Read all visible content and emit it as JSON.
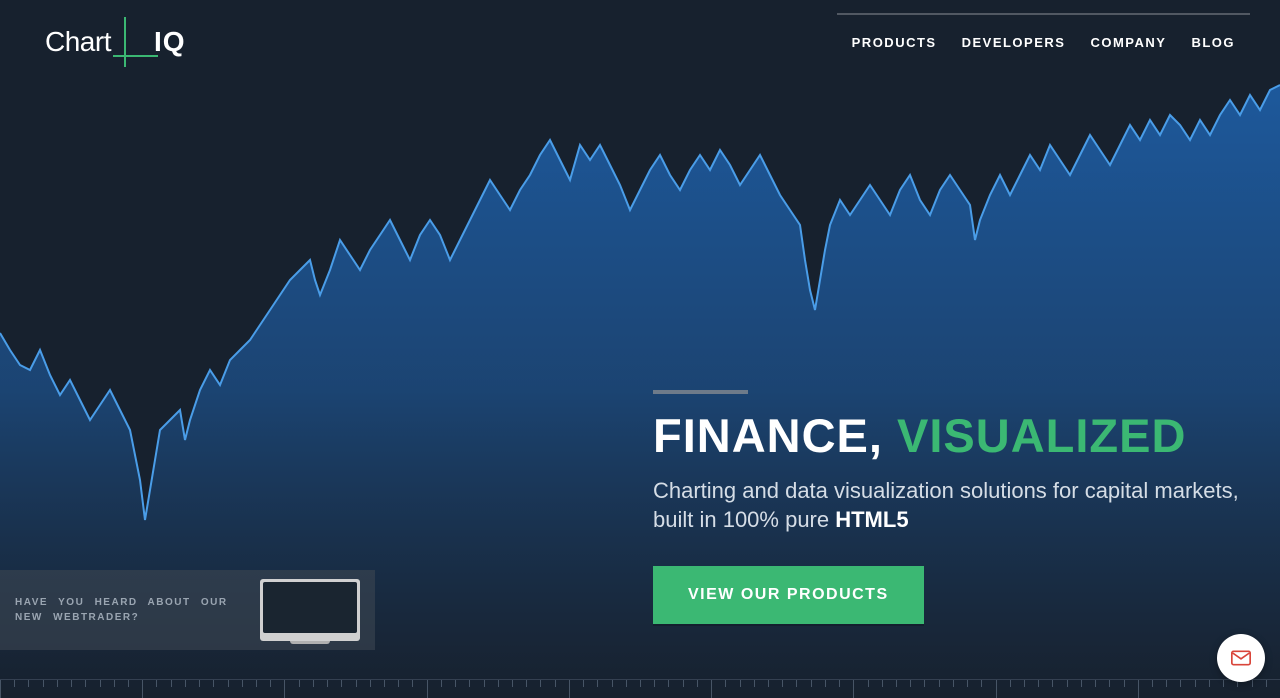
{
  "logo": {
    "part1": "Chart",
    "part2": "IQ"
  },
  "nav": {
    "items": [
      "PRODUCTS",
      "DEVELOPERS",
      "COMPANY",
      "BLOG"
    ]
  },
  "hero": {
    "title_part1": "FINANCE,",
    "title_part2": "VISUALIZED",
    "subtitle_part1": "Charting and data visualization solutions for capital markets, built in 100% pure ",
    "subtitle_strong": "HTML5",
    "cta_label": "VIEW OUR PRODUCTS"
  },
  "notification": {
    "text": "HAVE YOU HEARD ABOUT OUR NEW WEBTRADER?"
  }
}
